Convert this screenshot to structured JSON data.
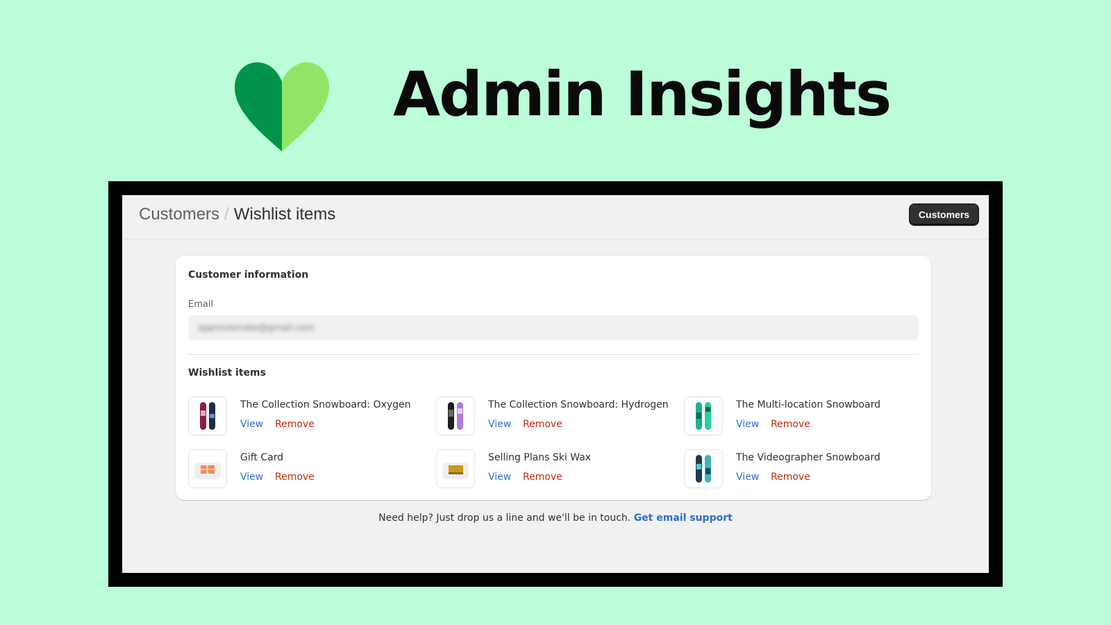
{
  "brand": {
    "title": "Admin Insights",
    "logo_icon": "heart-icon",
    "colors": {
      "background": "#bbfdd9",
      "heart_left": "#00944a",
      "heart_right": "#91e566"
    }
  },
  "topbar": {
    "breadcrumb_parent": "Customers",
    "breadcrumb_separator": "/",
    "breadcrumb_current": "Wishlist items",
    "button_label": "Customers"
  },
  "customer_info": {
    "title": "Customer information",
    "email_label": "Email",
    "email_value": "approvemate@gmail.com"
  },
  "wishlist": {
    "title": "Wishlist items",
    "view_label": "View",
    "remove_label": "Remove",
    "items": [
      {
        "name": "The Collection Snowboard: Oxygen",
        "thumb": "snowboard-icon"
      },
      {
        "name": "The Collection Snowboard: Hydrogen",
        "thumb": "snowboard-icon"
      },
      {
        "name": "The Multi-location Snowboard",
        "thumb": "snowboard-icon"
      },
      {
        "name": "Gift Card",
        "thumb": "gift-card-icon"
      },
      {
        "name": "Selling Plans Ski Wax",
        "thumb": "ski-wax-icon"
      },
      {
        "name": "The Videographer Snowboard",
        "thumb": "snowboard-icon"
      }
    ]
  },
  "footer": {
    "help_text": "Need help? Just drop us a line and we'll be in touch.",
    "link_text": "Get email support"
  },
  "colors": {
    "link": "#2c6ecb",
    "destructive": "#c5280c",
    "primary_button": "#303030"
  }
}
